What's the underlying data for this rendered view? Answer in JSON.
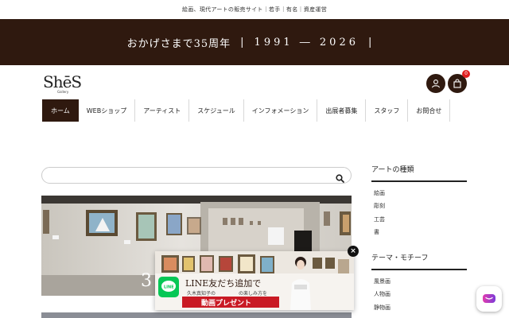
{
  "topbar": {
    "text": "絵画、現代アートの販売サイト｜若手｜有名｜資産運営"
  },
  "banner": {
    "text": "おかげさまで35周年",
    "years": "1991 ― 2026",
    "sep": "|"
  },
  "logo": {
    "main": "ShēS",
    "sub": "Gallery"
  },
  "cart": {
    "count": "0"
  },
  "nav": [
    {
      "label": "ホーム"
    },
    {
      "label": "WEBショップ"
    },
    {
      "label": "アーティスト"
    },
    {
      "label": "スケジュール"
    },
    {
      "label": "インフォメーション"
    },
    {
      "label": "出展者募集"
    },
    {
      "label": "スタッフ"
    },
    {
      "label": "お問合せ"
    }
  ],
  "search": {
    "placeholder": ""
  },
  "hero": {
    "overlay_text": "3"
  },
  "sidebar": {
    "types_heading": "アートの種類",
    "types": [
      "絵画",
      "彫刻",
      "工芸",
      "書"
    ],
    "motif_heading": "テーマ・モチーフ",
    "motifs": [
      "風景画",
      "人物画",
      "静物画"
    ]
  },
  "popup": {
    "line_label": "LINE",
    "title": "LINE友だち追加で",
    "subtitle_left": "久木真知子の",
    "subtitle_right": "の楽しみ方を",
    "cta": "動画プレゼント",
    "close": "×"
  },
  "colors": {
    "brand": "#2f190f",
    "line_green": "#06c755",
    "badge": "#e02020"
  }
}
